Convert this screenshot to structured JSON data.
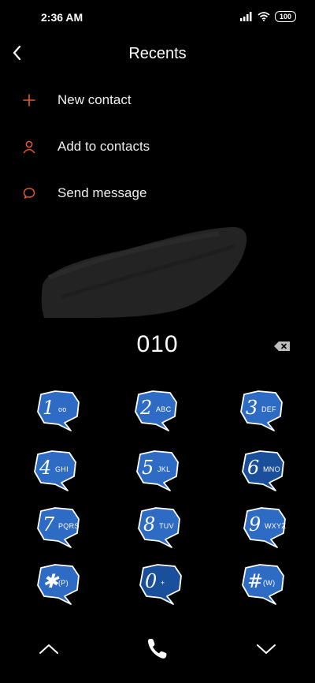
{
  "status_bar": {
    "time": "2:36 AM",
    "battery": "100"
  },
  "header": {
    "title": "Recents"
  },
  "menu": [
    {
      "label": "New contact",
      "icon": "plus-icon"
    },
    {
      "label": "Add to contacts",
      "icon": "person-icon"
    },
    {
      "label": "Send message",
      "icon": "chat-bubble-icon"
    }
  ],
  "dialer": {
    "number": "010",
    "keys": [
      {
        "digit": "1",
        "letters": "oo"
      },
      {
        "digit": "2",
        "letters": "ABC"
      },
      {
        "digit": "3",
        "letters": "DEF"
      },
      {
        "digit": "4",
        "letters": "GHI"
      },
      {
        "digit": "5",
        "letters": "JKL"
      },
      {
        "digit": "6",
        "letters": "MNO"
      },
      {
        "digit": "7",
        "letters": "PQRS"
      },
      {
        "digit": "8",
        "letters": "TUV"
      },
      {
        "digit": "9",
        "letters": "WXYZ"
      },
      {
        "digit": "✱",
        "letters": "(P)"
      },
      {
        "digit": "0",
        "letters": "+"
      },
      {
        "digit": "#",
        "letters": "(W)"
      }
    ]
  },
  "colors": {
    "accent": "#e8572a",
    "key_fill": "#2d6bc4",
    "key_dark": "#1a4f9c",
    "background": "#000000"
  }
}
